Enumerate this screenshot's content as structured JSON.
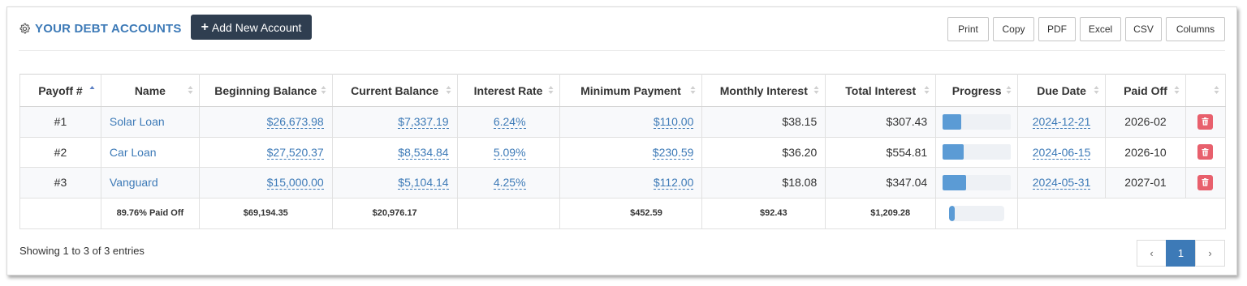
{
  "header": {
    "title": "YOUR DEBT ACCOUNTS",
    "add_button": "Add New Account",
    "export_buttons": [
      "Print",
      "Copy",
      "PDF",
      "Excel",
      "CSV",
      "Columns"
    ]
  },
  "table": {
    "columns": [
      "Payoff #",
      "Name",
      "Beginning Balance",
      "Current Balance",
      "Interest Rate",
      "Minimum Payment",
      "Monthly Interest",
      "Total Interest",
      "Progress",
      "Due Date",
      "Paid Off"
    ],
    "rows": [
      {
        "payoff": "#1",
        "name": "Solar Loan",
        "beginning_balance": "$26,673.98",
        "current_balance": "$7,337.19",
        "interest_rate": "6.24%",
        "minimum_payment": "$110.00",
        "monthly_interest": "$38.15",
        "total_interest": "$307.43",
        "progress": 0.27,
        "due_date": "2024-12-21",
        "paid_off": "2026-02"
      },
      {
        "payoff": "#2",
        "name": "Car Loan",
        "beginning_balance": "$27,520.37",
        "current_balance": "$8,534.84",
        "interest_rate": "5.09%",
        "minimum_payment": "$230.59",
        "monthly_interest": "$36.20",
        "total_interest": "$554.81",
        "progress": 0.31,
        "due_date": "2024-06-15",
        "paid_off": "2026-10"
      },
      {
        "payoff": "#3",
        "name": "Vanguard",
        "beginning_balance": "$15,000.00",
        "current_balance": "$5,104.14",
        "interest_rate": "4.25%",
        "minimum_payment": "$112.00",
        "monthly_interest": "$18.08",
        "total_interest": "$347.04",
        "progress": 0.34,
        "due_date": "2024-05-31",
        "paid_off": "2027-01"
      }
    ],
    "footer": {
      "paid_off_text": "89.76% Paid Off",
      "beginning_balance": "$69,194.35",
      "current_balance": "$20,976.17",
      "minimum_payment": "$452.59",
      "monthly_interest": "$92.43",
      "total_interest": "$1,209.28",
      "progress": 0.1
    }
  },
  "pagination": {
    "info": "Showing 1 to 3 of 3 entries",
    "prev": "‹",
    "page": "1",
    "next": "›"
  },
  "colors": {
    "accent": "#3d7ab7",
    "dark_button": "#2f3e50",
    "progress_fill": "#5b9bd5",
    "delete": "#e8606d"
  },
  "icons": {
    "settings": "gear-icon",
    "delete": "trash-icon",
    "sort": "sort-icon"
  }
}
